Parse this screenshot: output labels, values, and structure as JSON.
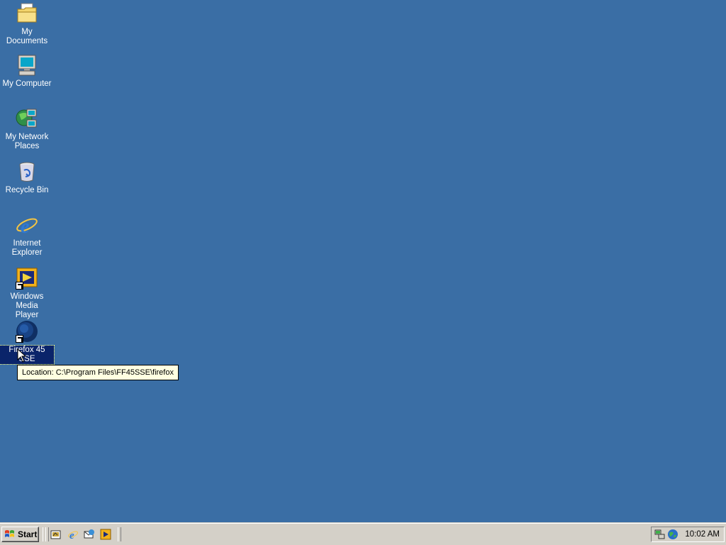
{
  "desktop": {
    "icons": [
      {
        "label": "My Documents"
      },
      {
        "label": "My Computer"
      },
      {
        "label": "My Network Places"
      },
      {
        "label": "Recycle Bin"
      },
      {
        "label": "Internet Explorer"
      },
      {
        "label": "Windows Media Player"
      },
      {
        "label": "Firefox 45 SSE"
      }
    ],
    "tooltip": "Location: C:\\Program Files\\FF45SSE\\firefox",
    "background_color": "#3a6ea5",
    "selection_color": "#0a246a"
  },
  "taskbar": {
    "start_label": "Start",
    "quick_launch": [
      "show-desktop-icon",
      "internet-explorer-icon",
      "outlook-express-icon",
      "windows-media-player-icon"
    ],
    "clock": "10:02 AM"
  }
}
